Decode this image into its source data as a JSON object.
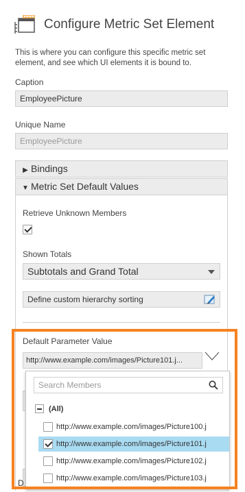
{
  "header": {
    "title": "Configure Metric Set Element",
    "icon": "metric-set-icon"
  },
  "description": "This is where you can configure this specific metric set element, and see which UI elements it is bound to.",
  "caption": {
    "label": "Caption",
    "value": "EmployeePicture"
  },
  "unique_name": {
    "label": "Unique Name",
    "value": "EmployeePicture"
  },
  "bindings": {
    "label": "Bindings"
  },
  "metric_defaults": {
    "label": "Metric Set Default Values",
    "retrieve_unknown": {
      "label": "Retrieve Unknown Members",
      "checked": true
    },
    "shown_totals": {
      "label": "Shown Totals",
      "value": "Subtotals and Grand Total"
    },
    "sort_button": {
      "label": "Define custom hierarchy sorting"
    },
    "default_param": {
      "label": "Default Parameter Value",
      "value": "http://www.example.com/images/Picture101.j..."
    }
  },
  "member_list": {
    "search_placeholder": "Search Members",
    "all_label": "(All)",
    "items": [
      {
        "label": "http://www.example.com/images/Picture100.j",
        "checked": false,
        "selected": false
      },
      {
        "label": "http://www.example.com/images/Picture101.j",
        "checked": true,
        "selected": true
      },
      {
        "label": "http://www.example.com/images/Picture102.j",
        "checked": false,
        "selected": false
      },
      {
        "label": "http://www.example.com/images/Picture103.j",
        "checked": false,
        "selected": false
      }
    ]
  },
  "colors": {
    "highlight": "#f58220",
    "selected_row": "#a9dbf2",
    "panel_bg": "#ececec"
  },
  "footer_fragment": "D"
}
